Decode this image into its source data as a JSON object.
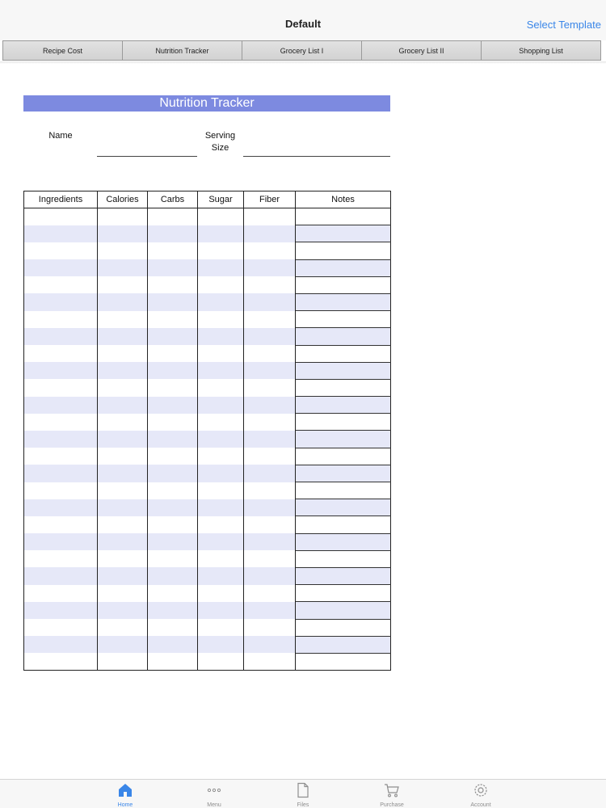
{
  "navbar": {
    "title": "Default",
    "action_label": "Select Template"
  },
  "tabs": [
    {
      "label": "Recipe Cost"
    },
    {
      "label": "Nutrition Tracker"
    },
    {
      "label": "Grocery List I"
    },
    {
      "label": "Grocery List II"
    },
    {
      "label": "Shopping List"
    }
  ],
  "sheet": {
    "title": "Nutrition Tracker",
    "name_label": "Name",
    "serving_label_line1": "Serving",
    "serving_label_line2": "Size",
    "columns": [
      "Ingredients",
      "Calories",
      "Carbs",
      "Sugar",
      "Fiber",
      "Notes"
    ],
    "row_count": 27,
    "stripe_color": "#e6e8f8",
    "banner_color": "#7d8ae0"
  },
  "tabbar": {
    "items": [
      {
        "label": "Home",
        "icon": "home-icon",
        "active": true
      },
      {
        "label": "Menu",
        "icon": "ellipsis-icon",
        "active": false
      },
      {
        "label": "Files",
        "icon": "file-icon",
        "active": false
      },
      {
        "label": "Purchase",
        "icon": "cart-icon",
        "active": false
      },
      {
        "label": "Account",
        "icon": "gear-icon",
        "active": false
      }
    ],
    "active_color": "#3a86e8"
  }
}
